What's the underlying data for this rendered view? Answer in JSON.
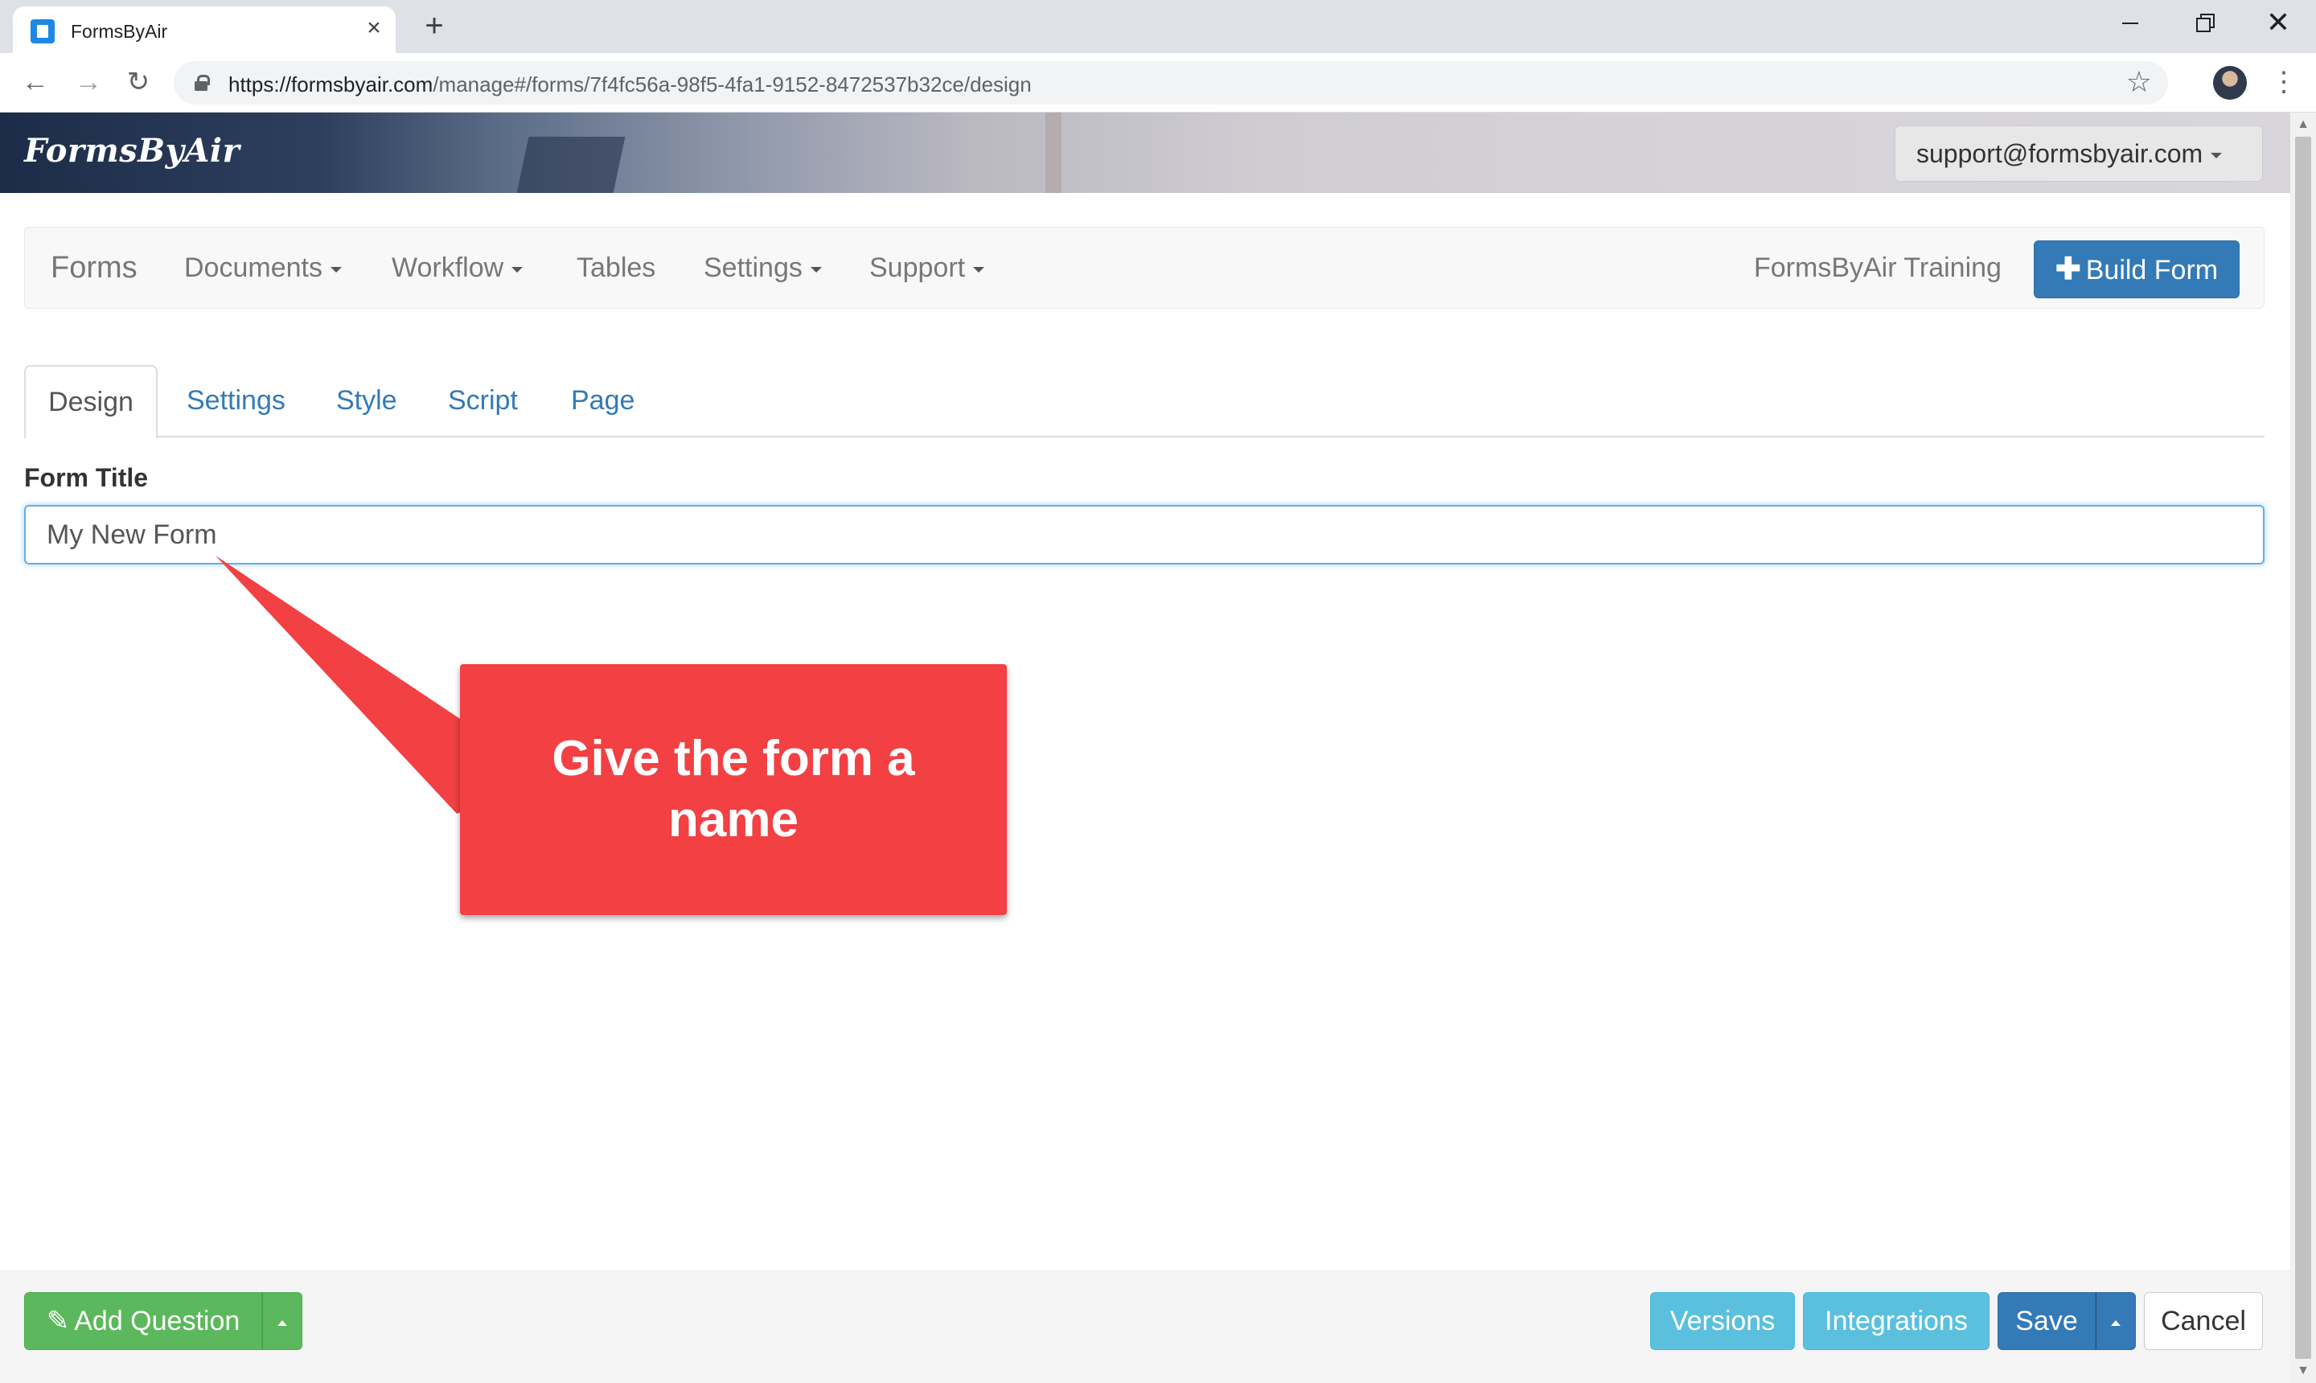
{
  "browser": {
    "tab_title": "FormsByAir",
    "tab_close": "×",
    "new_tab": "+",
    "url_host": "https://formsbyair.com",
    "url_path": "/manage#/forms/7f4fc56a-98f5-4fa1-9152-8472537b32ce/design",
    "icons": [
      "favicon-icon",
      "close-icon",
      "new-tab-icon",
      "minimize-icon",
      "restore-icon",
      "window-close-icon",
      "back-icon",
      "forward-icon",
      "reload-icon",
      "lock-icon",
      "star-icon",
      "profile-avatar",
      "kebab-menu-icon"
    ],
    "back": "←",
    "forward": "→",
    "reload": "↻",
    "star": "☆",
    "menu": "⋮",
    "win_close": "✕"
  },
  "header": {
    "brand": "FormsByAir",
    "user_email": "support@formsbyair.com"
  },
  "navbar": {
    "forms": "Forms",
    "documents": "Documents",
    "workflow": "Workflow",
    "tables": "Tables",
    "settings": "Settings",
    "support": "Support",
    "account": "FormsByAir Training",
    "build_form": "Build Form"
  },
  "tabs": {
    "design": "Design",
    "settings": "Settings",
    "style": "Style",
    "script": "Script",
    "page": "Page",
    "active": "Design"
  },
  "form": {
    "title_label": "Form Title",
    "title_value": "My New Form"
  },
  "callout": {
    "text": "Give the form a name",
    "color": "#f24043"
  },
  "footer": {
    "add_question": "Add Question",
    "versions": "Versions",
    "integrations": "Integrations",
    "save": "Save",
    "cancel": "Cancel"
  },
  "colors": {
    "primary": "#337ab7",
    "success": "#5cb85c",
    "info": "#5bc0de"
  }
}
